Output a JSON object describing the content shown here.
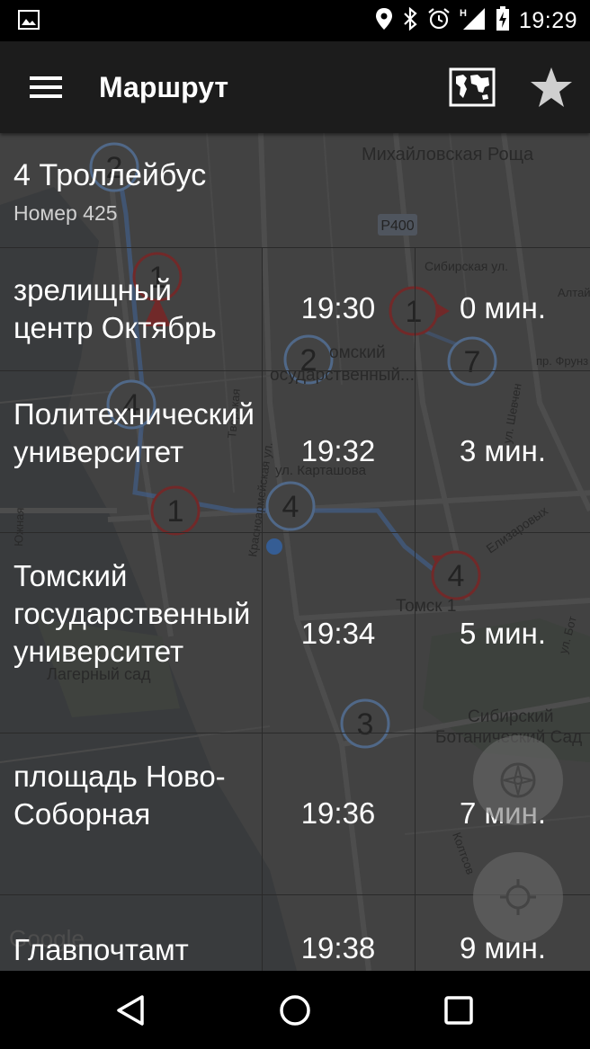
{
  "status_bar": {
    "time": "19:29",
    "icons": [
      "image-icon",
      "location-icon",
      "bluetooth-icon",
      "alarm-icon",
      "signal-h-icon",
      "battery-charging-icon"
    ]
  },
  "toolbar": {
    "title": "Маршрут",
    "icons": [
      "menu-icon",
      "world-map-icon",
      "star-icon"
    ]
  },
  "route": {
    "name": "4 Троллейбус",
    "number": "Номер 425"
  },
  "map_labels": {
    "district": "Михайловская Роща",
    "road": "Р400",
    "street_sibirskaya": "Сибирская ул.",
    "street_altai": "Алтай",
    "street_frunze": "пр. Фрунз",
    "university_a": "омский",
    "university_b": "осударственный...",
    "street_kartashova": "ул. Карташова",
    "street_krasnoarm": "Красноармейская ул.",
    "street_elizarovyh": "Елизаровых",
    "station": "Томск 1",
    "garden_lager": "Лагерный сад",
    "botanic_a": "Сибирский",
    "botanic_b": "Ботанический Сад",
    "street_shevch": "ул. Шевчен",
    "street_koltsov": "Колтсов",
    "street_tverskaya": "Тверская",
    "street_yuzh": "Южная",
    "street_both": "ул. Бот",
    "google": "Google",
    "markers": [
      "2",
      "1",
      "4",
      "1",
      "2",
      "7",
      "4",
      "4",
      "3",
      "1"
    ]
  },
  "stops": [
    {
      "name": "зрелищный центр Октябрь",
      "time": "19:30",
      "wait": "0 мин."
    },
    {
      "name": "Политехнический университет",
      "time": "19:32",
      "wait": "3 мин."
    },
    {
      "name": "Томский государственный университет",
      "time": "19:34",
      "wait": "5 мин."
    },
    {
      "name": "площадь Ново-Соборная",
      "time": "19:36",
      "wait": "7 мин."
    },
    {
      "name": "Главпочтамт",
      "time": "19:38",
      "wait": "9 мин."
    }
  ],
  "fabs": [
    "compass-icon",
    "my-location-icon"
  ],
  "nav_bar": [
    "back-icon",
    "home-icon",
    "recents-icon"
  ],
  "colors": {
    "map_background": "#4b4b4b",
    "route_line": "#4a6fa6",
    "marker_red": "#8a2a2a",
    "toolbar": "#1c1c1c"
  }
}
